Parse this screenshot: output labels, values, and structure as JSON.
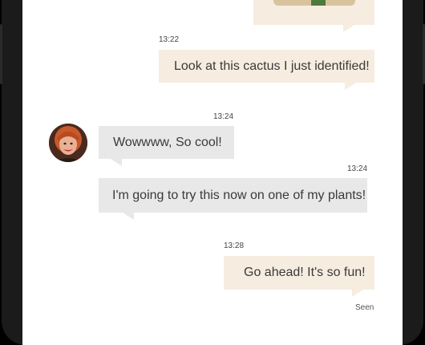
{
  "chat": {
    "messages": [
      {
        "kind": "image",
        "direction": "out"
      },
      {
        "time": "13:22",
        "text": "Look at this cactus I just identified!",
        "direction": "out"
      },
      {
        "time": "13:24",
        "text": "Wowwww, So cool!",
        "direction": "in"
      },
      {
        "time": "13:24",
        "text": "I'm going to try this now on one of my plants!",
        "direction": "in"
      },
      {
        "time": "13:28",
        "text": "Go ahead! It's so fun!",
        "direction": "out"
      }
    ],
    "seen_label": "Seen"
  },
  "colors": {
    "outgoing_bubble": "#f6ece0",
    "incoming_bubble": "#e8e8e8",
    "screen_bg": "#ffffff",
    "frame": "#000000"
  },
  "icons": {
    "avatar": "contact-avatar"
  }
}
